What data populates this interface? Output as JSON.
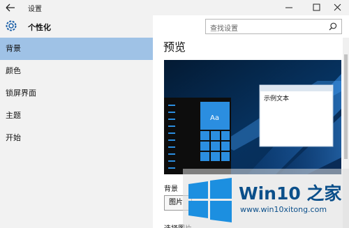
{
  "window": {
    "title": "设置",
    "back_icon": "back-arrow-icon",
    "min_icon": "minimize-icon",
    "max_icon": "maximize-icon",
    "close_icon": "close-icon"
  },
  "header": {
    "title": "个性化",
    "icon": "gear-icon"
  },
  "search": {
    "placeholder": "查找设置",
    "icon": "search-icon"
  },
  "nav": {
    "items": [
      {
        "label": "背景",
        "selected": true
      },
      {
        "label": "颜色",
        "selected": false
      },
      {
        "label": "锁屏界面",
        "selected": false
      },
      {
        "label": "主题",
        "selected": false
      },
      {
        "label": "开始",
        "selected": false
      }
    ]
  },
  "main": {
    "preview_title": "预览",
    "preview_sample_text": "示例文本",
    "preview_tile_text": "Aa",
    "background_label": "背景",
    "background_value": "图片",
    "choose_label": "选择图片"
  },
  "watermark": {
    "title": "Win10 之家",
    "url": "www.win10xitong.com"
  },
  "colors": {
    "accent": "#9fc2e6",
    "tile": "#2b8ee0",
    "desktop": "#06325f",
    "watermark": "#0b4f8a"
  }
}
